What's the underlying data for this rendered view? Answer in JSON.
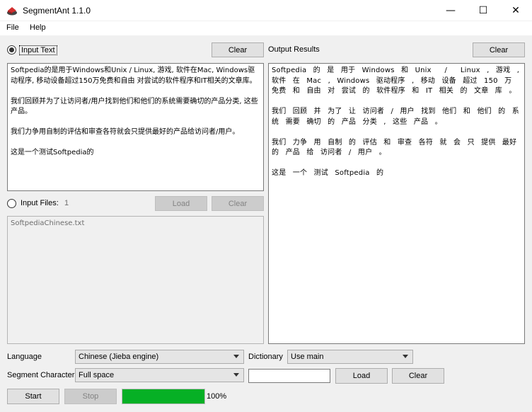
{
  "window": {
    "title": "SegmentAnt 1.1.0",
    "minimize_symbol": "—",
    "maximize_symbol": "☐",
    "close_symbol": "✕"
  },
  "menu": [
    "File",
    "Help"
  ],
  "input_text": {
    "radio_label": "Input Text",
    "selected": true,
    "clear_label": "Clear",
    "content": "Softpedia的是用于Windows和Unix / Linux, 游戏, 软件在Mac, Windows驱动程序, 移动设备超过150万免费和自由 对尝试的软件程序和IT相关的文章库。\n\n我们回顾并为了让访问者/用户找到他们和他们的系统需要确切的产品分类, 这些产品。\n\n我们力争用自制的评估和审查各符就会只提供最好的产品给访问者/用户。\n\n这是一个测试Softpedia的"
  },
  "output": {
    "label": "Output  Results",
    "clear_label": "Clear",
    "content": "Softpedia 的 是 用于 Windows 和 Unix  /  Linux , 游戏 , 软件 在 Mac , Windows 驱动程序 , 移动 设备 超过 150 万 免费 和 自由 对 尝试 的 软件程序 和 IT 相关 的 文章 库 。\n\n我们 回顾 并 为了 让 访问者 / 用户 找到 他们 和 他们 的 系统 需要 确切 的 产品 分类 , 这些 产品 。\n\n我们 力争 用 自制 的 评估 和 审查 各符 就 会 只 提供 最好 的 产品 给 访问者 / 用户 。\n\n这是 一个 测试 Softpedia 的"
  },
  "input_files": {
    "radio_label": "Input Files:",
    "selected": false,
    "count": "1",
    "load_label": "Load",
    "clear_label": "Clear",
    "files": "SoftpediaChinese.txt"
  },
  "settings": {
    "language_label": "Language",
    "language_value": "Chinese (Jieba engine)",
    "dictionary_label": "Dictionary",
    "dictionary_value": "Use main",
    "segment_label": "Segment Character",
    "segment_value": "Full space",
    "dict_path": "",
    "load_label": "Load",
    "clear_label": "Clear"
  },
  "actions": {
    "start_label": "Start",
    "stop_label": "Stop",
    "progress": 1.0,
    "progress_text": "100%"
  },
  "colors": {
    "progress_fill": "#06b025"
  }
}
